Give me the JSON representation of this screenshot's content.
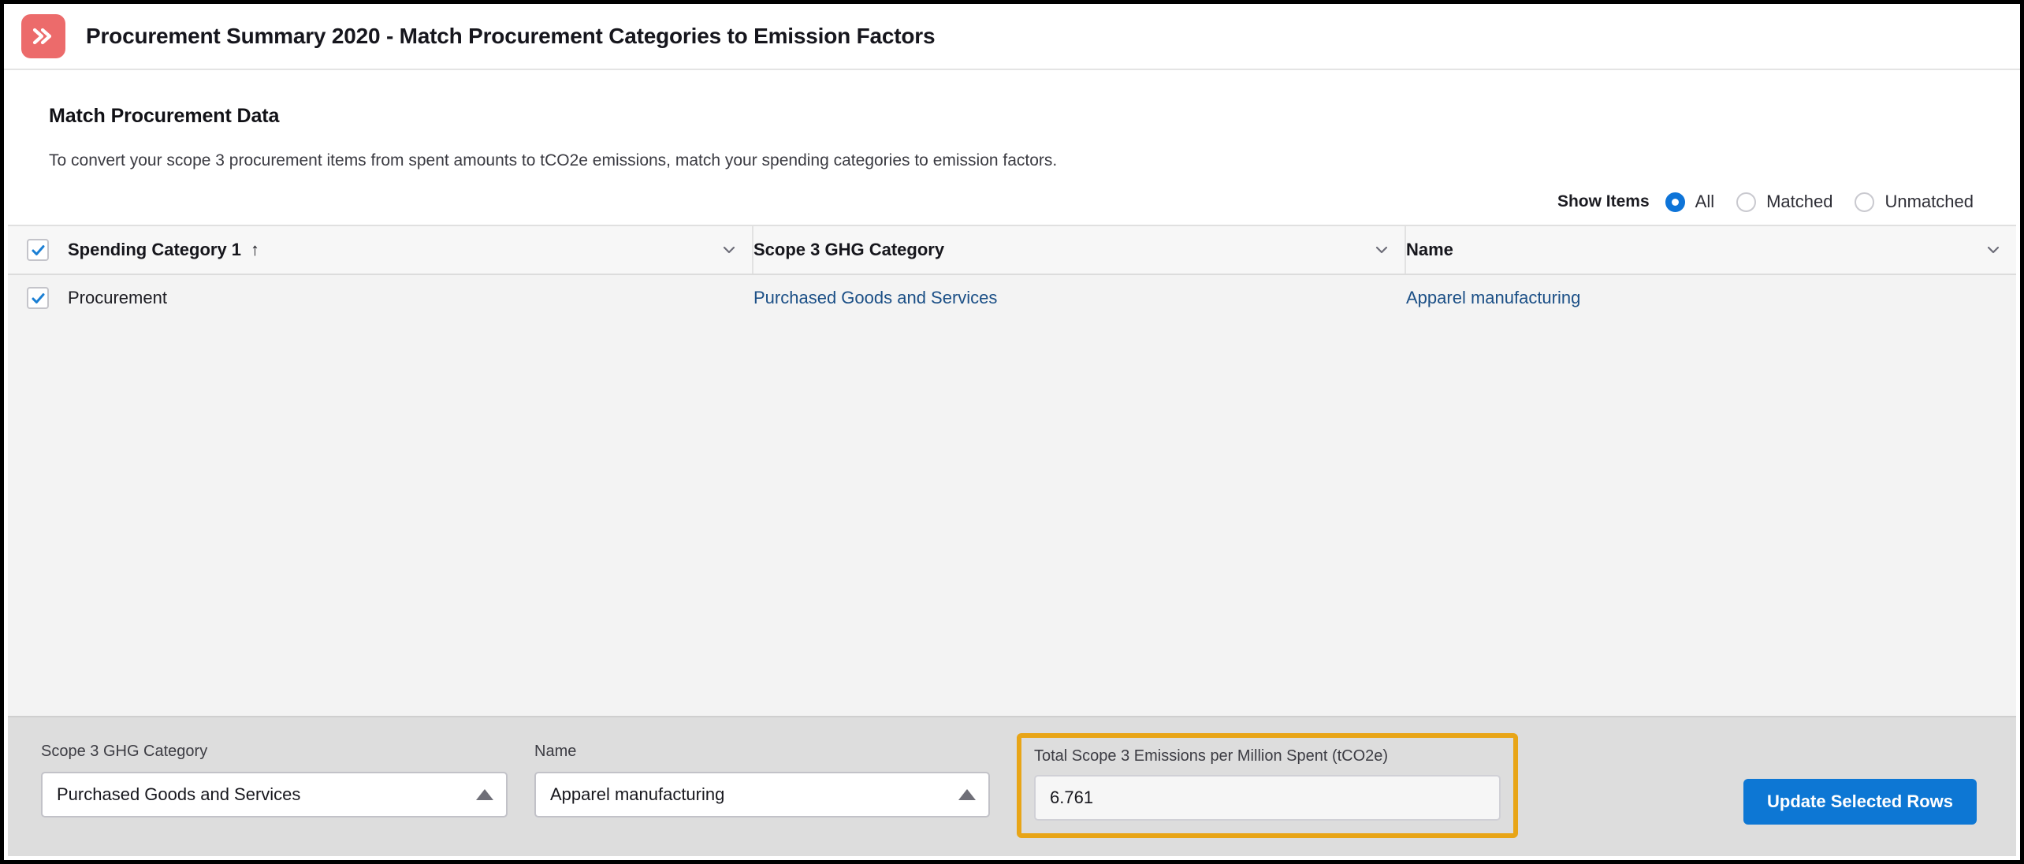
{
  "window": {
    "title": "Procurement Summary 2020 - Match Procurement Categories to Emission Factors",
    "app_icon": "fast-forward-arrow-icon",
    "accent_color": "#ec6b6b"
  },
  "page": {
    "heading": "Match Procurement Data",
    "description": "To convert your scope 3 procurement items from spent amounts to tCO2e emissions, match your spending categories to emission factors."
  },
  "filter": {
    "label": "Show Items",
    "options": [
      {
        "label": "All",
        "selected": true
      },
      {
        "label": "Matched",
        "selected": false
      },
      {
        "label": "Unmatched",
        "selected": false
      }
    ],
    "selected_color": "#0e74d8"
  },
  "table": {
    "select_all_checked": true,
    "columns": [
      {
        "label": "Spending Category 1",
        "sort": "↑",
        "menu_icon": "chevron-down-icon"
      },
      {
        "label": "Scope 3 GHG Category",
        "sort": "",
        "menu_icon": "chevron-down-icon"
      },
      {
        "label": "Name",
        "sort": "",
        "menu_icon": "chevron-down-icon"
      }
    ],
    "rows": [
      {
        "checked": true,
        "spending_category": "Procurement",
        "scope3_category": "Purchased Goods and Services",
        "name": "Apparel manufacturing"
      }
    ]
  },
  "editor": {
    "scope3_label": "Scope 3 GHG Category",
    "scope3_value": "Purchased Goods and Services",
    "name_label": "Name",
    "name_value": "Apparel manufacturing",
    "emissions_label": "Total Scope 3 Emissions per Million Spent (tCO2e)",
    "emissions_value": "6.761",
    "highlight_color": "#e8a517",
    "update_button": "Update Selected Rows",
    "button_color": "#0d77d4"
  }
}
